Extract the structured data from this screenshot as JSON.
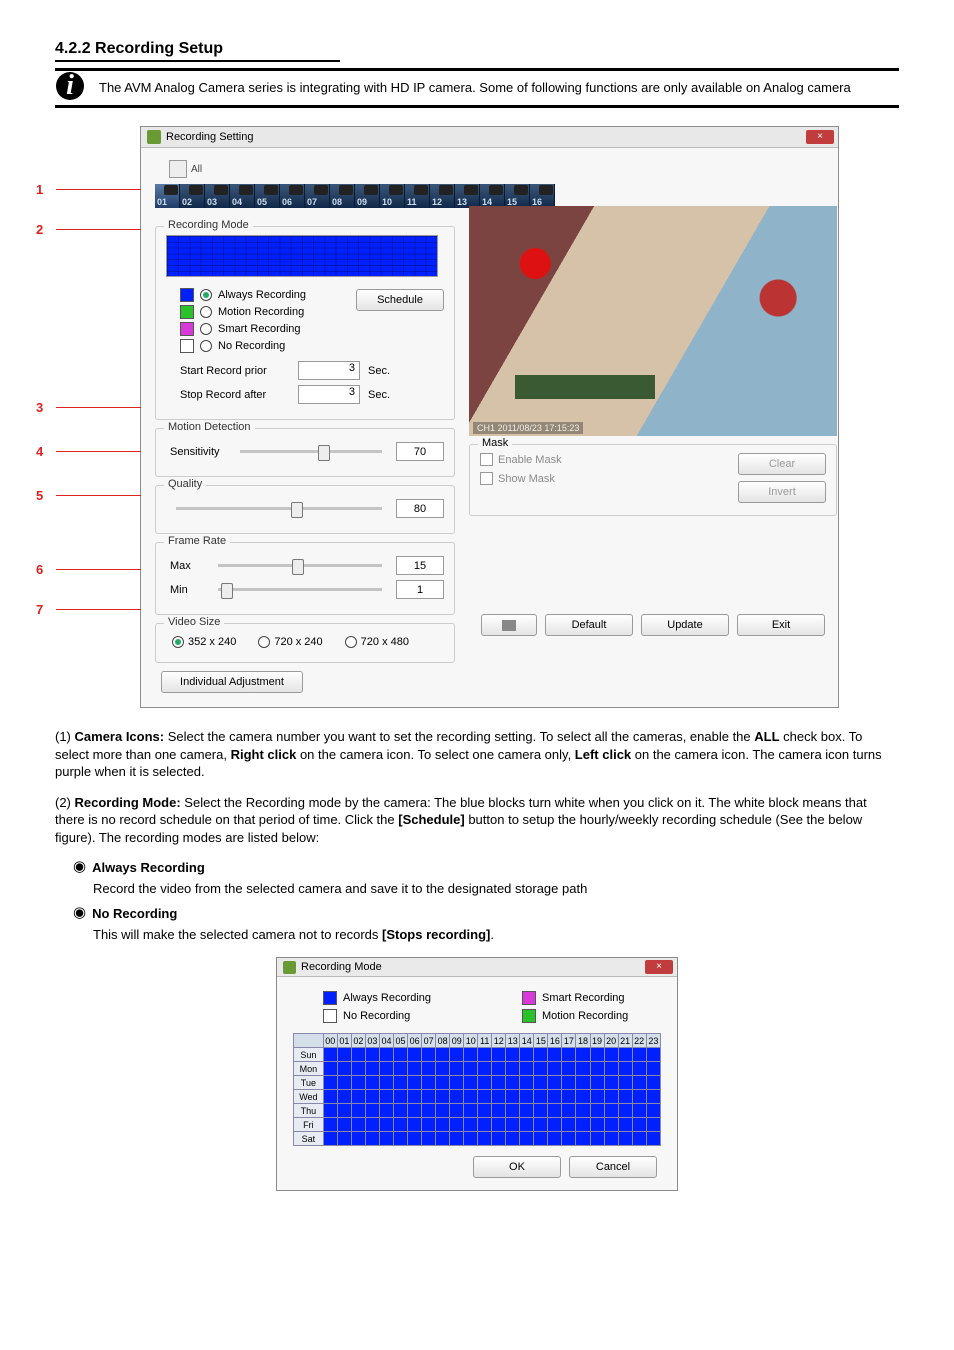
{
  "heading": "4.2.2 Recording Setup",
  "info_text": "The  AVM  Analog  Camera  series  is  integrating  with  HD  IP  camera.  Some  of  following  functions  are  only available on Analog camera",
  "window": {
    "title": "Recording Setting",
    "close_sym": "×"
  },
  "toolbar": {
    "all_txt": "All"
  },
  "cameras": [
    "01",
    "02",
    "03",
    "04",
    "05",
    "06",
    "07",
    "08",
    "09",
    "10",
    "11",
    "12",
    "13",
    "14",
    "15",
    "16"
  ],
  "recmode": {
    "legend": "Recording Mode",
    "always": "Always Recording",
    "motion": "Motion Recording",
    "smart": "Smart Recording",
    "none": "No Recording",
    "schedule_btn": "Schedule",
    "start_prior": "Start Record prior",
    "stop_after": "Stop Record after",
    "start_val": "3",
    "stop_val": "3",
    "sec": "Sec."
  },
  "motion": {
    "legend": "Motion Detection",
    "sensitivity": "Sensitivity",
    "sens_val": "70"
  },
  "quality": {
    "legend": "Quality",
    "val": "80"
  },
  "frame": {
    "legend": "Frame Rate",
    "max": "Max",
    "min": "Min",
    "max_val": "15",
    "min_val": "1"
  },
  "vsize": {
    "legend": "Video Size",
    "a": "352 x 240",
    "b": "720 x 240",
    "c": "720 x 480"
  },
  "indiv_btn": "Individual Adjustment",
  "preview_overlay": "CH1 2011/08/23 17:15:23",
  "mask": {
    "legend": "Mask",
    "enable": "Enable Mask",
    "show": "Show Mask",
    "clear": "Clear",
    "invert": "Invert"
  },
  "bottom": {
    "default": "Default",
    "update": "Update",
    "exit": "Exit"
  },
  "callouts": [
    "1",
    "2",
    "3",
    "4",
    "5",
    "6",
    "7"
  ],
  "body": {
    "l1_num": "(1)",
    "l1_label": "Camera Icons:",
    "l1_text": " Select the camera number you want to set the recording setting. To select all the cameras, enable the ",
    "l1_bold_all": "ALL",
    "l1_text2": " check box. To select more than one camera, ",
    "l1_right": "Right click",
    "l1_text3": " on the camera icon. To select one camera only, ",
    "l1_left": "Left click ",
    "l1_text4": "on the camera icon. The camera icon turns purple when it is selected.",
    "l2_num": "(2)",
    "l2_label": "Recording Mode:",
    "l2_text": " Select the Recording mode by the camera: The blue blocks turn white when you click on it. The white block means that there is no record schedule on that period of time. Click the ",
    "l2_bold": "[Schedule]",
    "l2_text2": " button to setup the hourly/weekly recording schedule (See the below figure). The recording modes are listed below:",
    "always_label": "Always Recording",
    "always_text": "Record the video from the selected camera and save it to the designated storage path",
    "norec_label": "No Recording",
    "norec_text": "This will make the selected camera not to records ",
    "norec_bold": "[Stops recording]",
    "norec_text2": "."
  },
  "shot2": {
    "title": "Recording Mode",
    "a": "Always Recording",
    "b": "No Recording",
    "c": "Smart Recording",
    "d": "Motion Recording",
    "hours": [
      "00",
      "01",
      "02",
      "03",
      "04",
      "05",
      "06",
      "07",
      "08",
      "09",
      "10",
      "11",
      "12",
      "13",
      "14",
      "15",
      "16",
      "17",
      "18",
      "19",
      "20",
      "21",
      "22",
      "23"
    ],
    "days": [
      "Sun",
      "Mon",
      "Tue",
      "Wed",
      "Thu",
      "Fri",
      "Sat"
    ],
    "ok": "OK",
    "cancel": "Cancel"
  }
}
